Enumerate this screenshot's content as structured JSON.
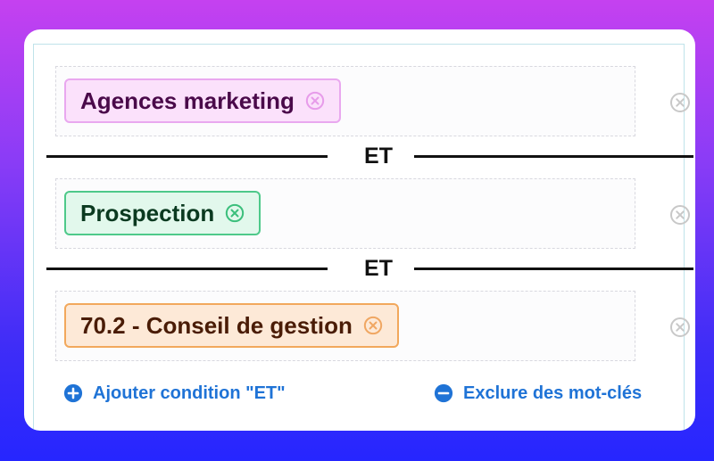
{
  "conditions": [
    {
      "label": "Agences marketing"
    },
    {
      "label": "Prospection"
    },
    {
      "label": "70.2 - Conseil de gestion"
    }
  ],
  "operators": [
    "ET",
    "ET"
  ],
  "actions": {
    "add_condition": "Ajouter condition \"ET\"",
    "exclude_keywords": "Exclure des mot-clés"
  },
  "colors": {
    "accent": "#1f73d6",
    "tag_pink": "#fbe1fb",
    "tag_green": "#e2f8ec",
    "tag_orange": "#fde9d7"
  },
  "icons": [
    "close-circle-icon",
    "plus-circle-icon",
    "minus-circle-icon"
  ]
}
